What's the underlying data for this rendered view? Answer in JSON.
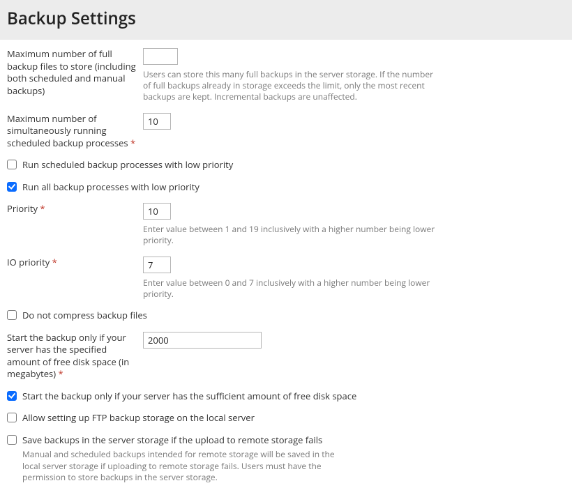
{
  "header": {
    "title": "Backup Settings"
  },
  "fields": {
    "max_full_backups": {
      "label": "Maximum number of full backup files to store (including both scheduled and manual backups)",
      "value": "",
      "hint": "Users can store this many full backups in the server storage. If the number of full backups already in storage exceeds the limit, only the most recent backups are kept. Incremental backups are unaffected."
    },
    "max_processes": {
      "label": "Maximum number of simultaneously running scheduled backup processes",
      "value": "10"
    },
    "scheduled_low_priority": {
      "label": "Run scheduled backup processes with low priority",
      "checked": false
    },
    "all_low_priority": {
      "label": "Run all backup processes with low priority",
      "checked": true
    },
    "priority": {
      "label": "Priority",
      "value": "10",
      "hint": "Enter value between 1 and 19 inclusively with a higher number being lower priority."
    },
    "io_priority": {
      "label": "IO priority",
      "value": "7",
      "hint": "Enter value between 0 and 7 inclusively with a higher number being lower priority."
    },
    "no_compress": {
      "label": "Do not compress backup files",
      "checked": false
    },
    "free_space_mb": {
      "label": "Start the backup only if your server has the specified amount of free disk space (in megabytes)",
      "value": "2000"
    },
    "sufficient_space": {
      "label": "Start the backup only if your server has the sufficient amount of free disk space",
      "checked": true
    },
    "allow_local_ftp": {
      "label": "Allow setting up FTP backup storage on the local server",
      "checked": false
    },
    "save_on_fail": {
      "label": "Save backups in the server storage if the upload to remote storage fails",
      "checked": false,
      "hint": "Manual and scheduled backups intended for remote storage will be saved in the local server storage if uploading to remote storage fails. Users must have the permission to store backups in the server storage."
    }
  },
  "required_marker": "*"
}
